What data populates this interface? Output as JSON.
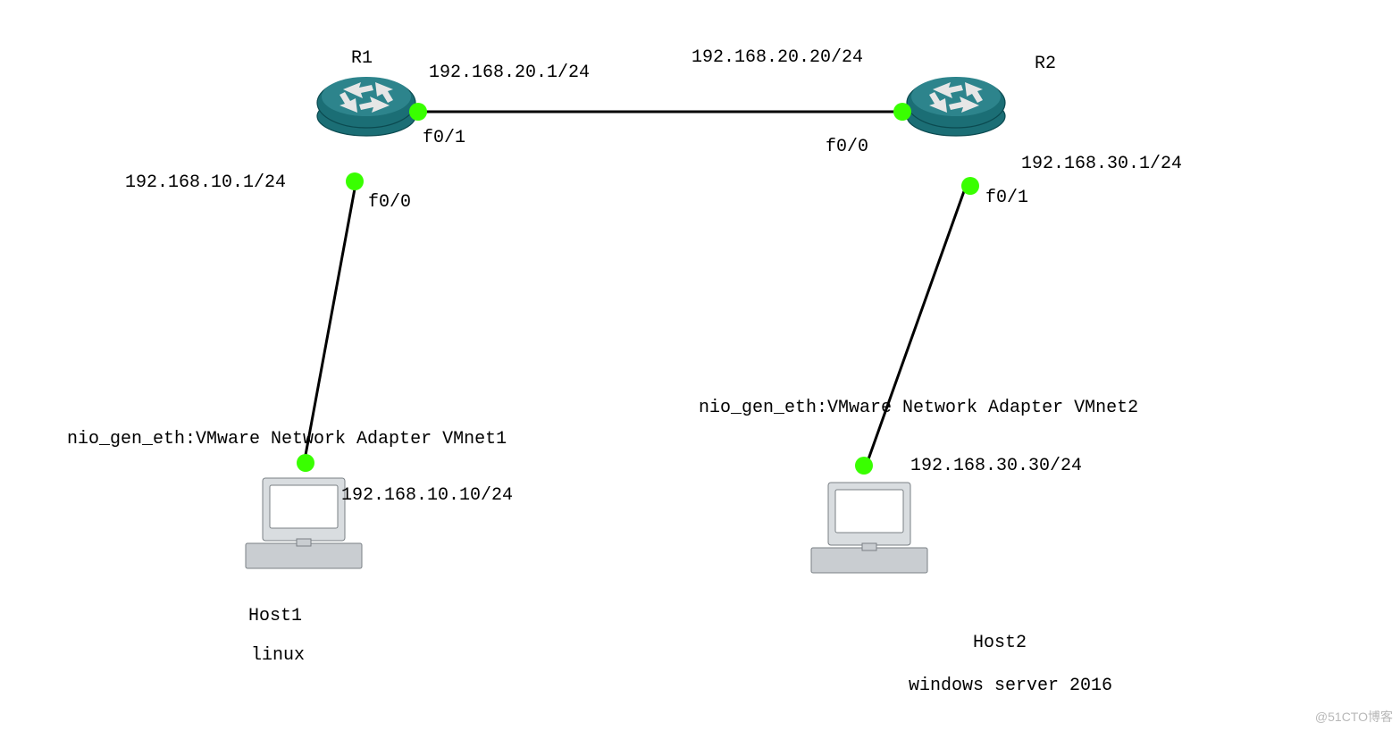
{
  "routers": {
    "r1": {
      "name": "R1",
      "if_left": "f0/0",
      "if_right": "f0/1",
      "ip_left": "192.168.10.1/24",
      "ip_right": "192.168.20.1/24"
    },
    "r2": {
      "name": "R2",
      "if_left": "f0/0",
      "if_right": "f0/1",
      "ip_left": "192.168.20.20/24",
      "ip_right": "192.168.30.1/24"
    }
  },
  "hosts": {
    "h1": {
      "name": "Host1",
      "os": "linux",
      "adapter": "nio_gen_eth:VMware Network Adapter VMnet1",
      "ip": "192.168.10.10/24"
    },
    "h2": {
      "name": "Host2",
      "os": "windows server 2016",
      "adapter": "nio_gen_eth:VMware Network Adapter VMnet2",
      "ip": "192.168.30.30/24"
    }
  },
  "watermark": "@51CTO博客"
}
